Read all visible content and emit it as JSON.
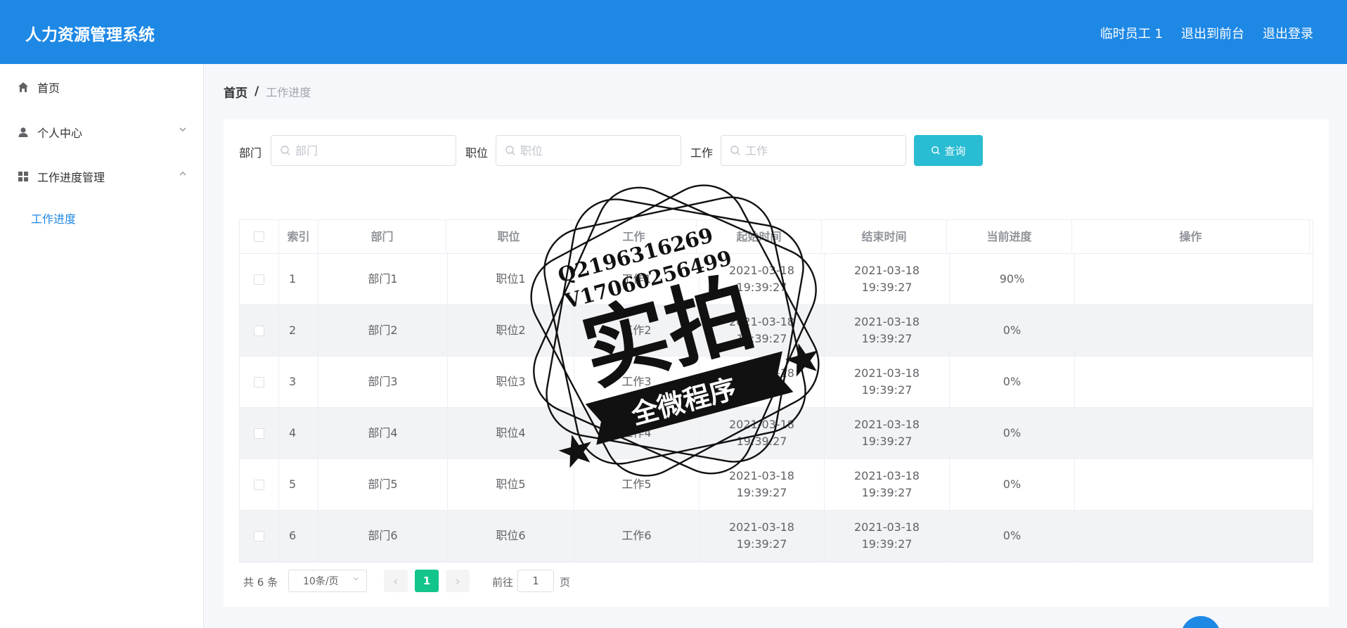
{
  "header": {
    "brand": "人力资源管理系统",
    "nav": [
      "临时员工 1",
      "退出到前台",
      "退出登录"
    ]
  },
  "sidebar": {
    "items": [
      {
        "label": "首页",
        "icon": "home-icon"
      },
      {
        "label": "个人中心",
        "icon": "user-icon"
      },
      {
        "label": "工作进度管理",
        "icon": "grid-icon"
      }
    ],
    "sub_items": [
      {
        "label": "工作进度"
      }
    ]
  },
  "breadcrumb": {
    "home": "首页",
    "separator": "/",
    "current": "工作进度"
  },
  "search": {
    "dept_label": "部门",
    "dept_placeholder": "部门",
    "position_label": "职位",
    "position_placeholder": "职位",
    "work_label": "工作",
    "work_placeholder": "工作",
    "button": "查询"
  },
  "table": {
    "columns": [
      "索引",
      "部门",
      "职位",
      "工作",
      "起始时间",
      "结束时间",
      "当前进度",
      "操作"
    ],
    "rows": [
      {
        "index": "1",
        "dept": "部门1",
        "position": "职位1",
        "work": "工作1",
        "start": "2021-03-18 19:39:27",
        "end": "2021-03-18 19:39:27",
        "progress": "90%"
      },
      {
        "index": "2",
        "dept": "部门2",
        "position": "职位2",
        "work": "工作2",
        "start": "2021-03-18 19:39:27",
        "end": "2021-03-18 19:39:27",
        "progress": "0%"
      },
      {
        "index": "3",
        "dept": "部门3",
        "position": "职位3",
        "work": "工作3",
        "start": "2021-03-18 19:39:27",
        "end": "2021-03-18 19:39:27",
        "progress": "0%"
      },
      {
        "index": "4",
        "dept": "部门4",
        "position": "职位4",
        "work": "工作4",
        "start": "2021-03-18 19:39:27",
        "end": "2021-03-18 19:39:27",
        "progress": "0%"
      },
      {
        "index": "5",
        "dept": "部门5",
        "position": "职位5",
        "work": "工作5",
        "start": "2021-03-18 19:39:27",
        "end": "2021-03-18 19:39:27",
        "progress": "0%"
      },
      {
        "index": "6",
        "dept": "部门6",
        "position": "职位6",
        "work": "工作6",
        "start": "2021-03-18 19:39:27",
        "end": "2021-03-18 19:39:27",
        "progress": "0%"
      }
    ]
  },
  "pagination": {
    "total": "共 6 条",
    "page_size": "10条/页",
    "current_page": "1",
    "goto_prefix": "前往",
    "goto_value": "1",
    "goto_suffix": "页"
  },
  "watermark": {
    "line1": "Q2196316269",
    "line2": "V17060256499",
    "main": "实拍",
    "banner": "全微程序"
  },
  "colors": {
    "header": "#1e88e5",
    "query_button": "#29bcd2",
    "active_page": "#13c58d",
    "active_submenu": "#1e88e5"
  }
}
